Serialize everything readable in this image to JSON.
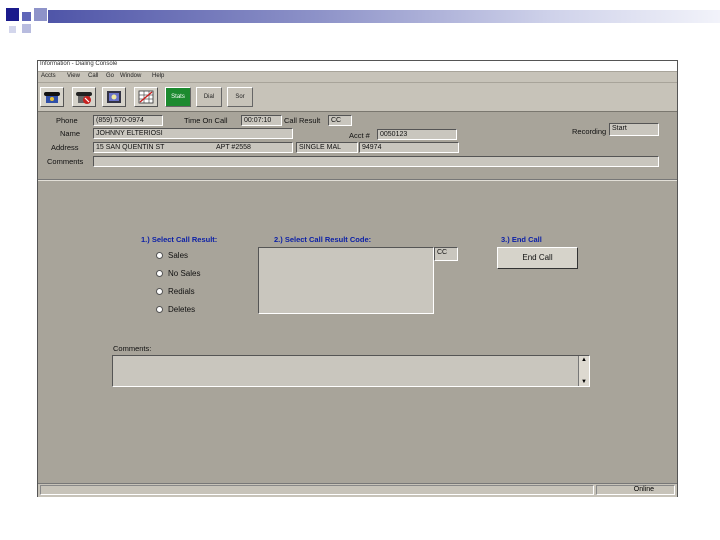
{
  "window": {
    "title": "Information - Dialing Console",
    "menu": [
      "Accts",
      "View",
      "Call",
      "Go",
      "Window",
      "Help"
    ]
  },
  "toolbar": {
    "icons": [
      "dial-phone-icon",
      "hangup-icon",
      "callback-icon",
      "schedule-icon"
    ],
    "stats_label": "Stats",
    "button2_label": "Dial",
    "button3_label": "Sor"
  },
  "info": {
    "phone_label": "Phone",
    "phone_value": "(859) 570-0974",
    "time_on_call_label": "Time On Call",
    "time_on_call_value": "00:07:10",
    "call_result_label": "Call Result",
    "call_result_value": "CC",
    "name_label": "Name",
    "name_value": "JOHNNY ELTERIOSI",
    "acct_label": "Acct #",
    "acct_value": "0050123",
    "recording_label": "Recording",
    "recording_value": "Start",
    "address_label": "Address",
    "address_value": "15 SAN QUENTIN ST",
    "apt_value": "APT #2558",
    "city_value": "SINGLE MAL",
    "zip_value": "94974",
    "comments_label": "Comments"
  },
  "call_panel": {
    "step1_label": "1.) Select Call Result:",
    "step2_label": "2.) Select Call Result Code:",
    "step3_label": "3.) End Call",
    "results": [
      "Sales",
      "No Sales",
      "Redials",
      "Deletes"
    ],
    "code_value": "CC",
    "end_call_label": "End Call",
    "comments_label": "Comments:"
  },
  "status": {
    "mode": "Online"
  }
}
